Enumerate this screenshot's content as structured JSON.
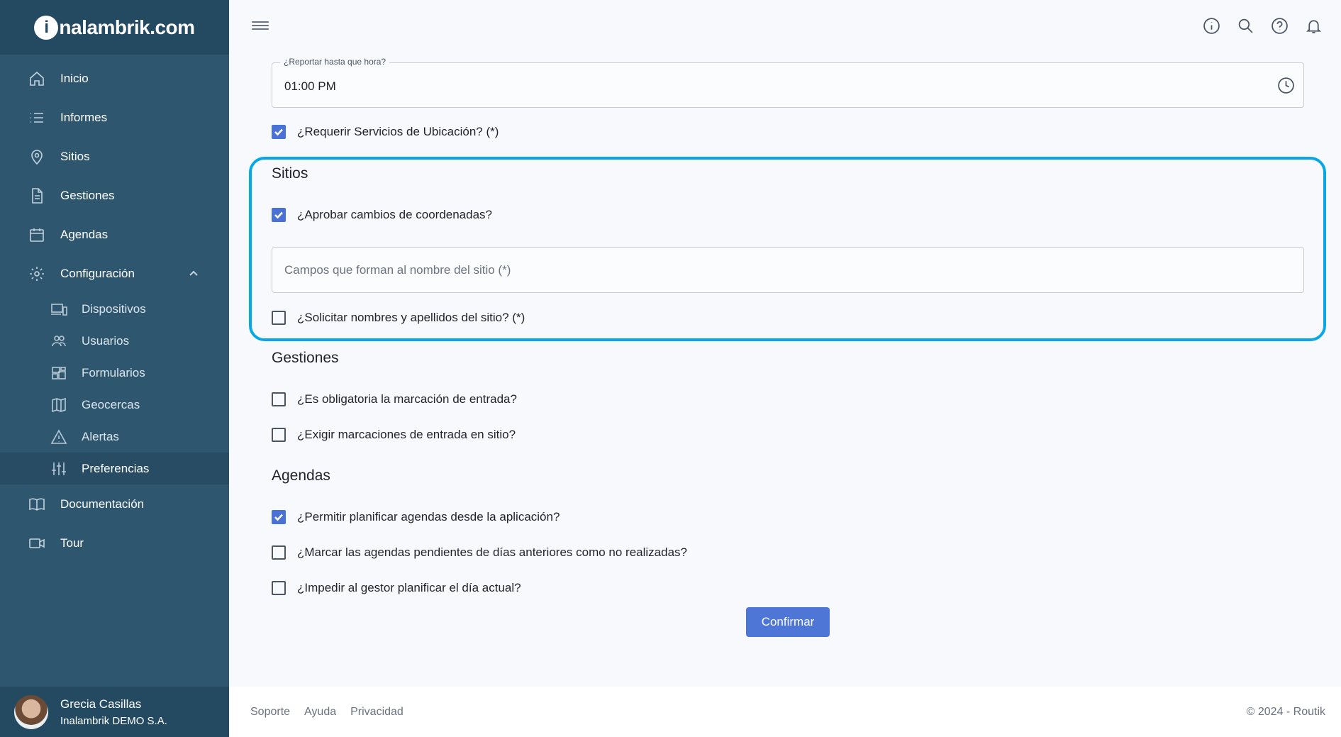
{
  "brand": {
    "logo_letter": "i",
    "logo_text": "nalambrik.com"
  },
  "sidebar": {
    "items": [
      {
        "label": "Inicio",
        "icon": "home-icon"
      },
      {
        "label": "Informes",
        "icon": "list-icon"
      },
      {
        "label": "Sitios",
        "icon": "map-pin-icon"
      },
      {
        "label": "Gestiones",
        "icon": "document-icon"
      },
      {
        "label": "Agendas",
        "icon": "calendar-icon"
      },
      {
        "label": "Configuración",
        "icon": "gear-icon",
        "expanded": true
      }
    ],
    "subitems": [
      {
        "label": "Dispositivos",
        "icon": "devices-icon"
      },
      {
        "label": "Usuarios",
        "icon": "users-icon"
      },
      {
        "label": "Formularios",
        "icon": "forms-icon"
      },
      {
        "label": "Geocercas",
        "icon": "map-icon"
      },
      {
        "label": "Alertas",
        "icon": "warning-icon"
      },
      {
        "label": "Preferencias",
        "icon": "sliders-icon",
        "active": true
      }
    ],
    "bottom_items": [
      {
        "label": "Documentación",
        "icon": "book-icon"
      },
      {
        "label": "Tour",
        "icon": "video-icon"
      }
    ]
  },
  "user": {
    "name": "Grecia Casillas",
    "org": "Inalambrik DEMO S.A."
  },
  "header": {
    "icons": [
      "info-icon",
      "search-icon",
      "help-icon",
      "bell-icon"
    ]
  },
  "form": {
    "report_until": {
      "label": "¿Reportar hasta que hora?",
      "value": "01:00 PM"
    },
    "require_location": {
      "label": "¿Requerir Servicios de Ubicación? (*)",
      "checked": true
    },
    "sitios": {
      "title": "Sitios",
      "approve_coords": {
        "label": "¿Aprobar cambios de coordenadas?",
        "checked": true
      },
      "name_fields_placeholder": "Campos que forman al nombre del sitio (*)",
      "request_names": {
        "label": "¿Solicitar nombres y apellidos del sitio? (*)",
        "checked": false
      }
    },
    "gestiones": {
      "title": "Gestiones",
      "mandatory_checkin": {
        "label": "¿Es obligatoria la marcación de entrada?",
        "checked": false
      },
      "require_checkin_site": {
        "label": "¿Exigir marcaciones de entrada en sitio?",
        "checked": false
      }
    },
    "agendas": {
      "title": "Agendas",
      "allow_planning": {
        "label": "¿Permitir planificar agendas desde la aplicación?",
        "checked": true
      },
      "mark_pending": {
        "label": "¿Marcar las agendas pendientes de días anteriores como no realizadas?",
        "checked": false
      },
      "prevent_today": {
        "label": "¿Impedir al gestor planificar el día actual?",
        "checked": false
      }
    },
    "confirm_label": "Confirmar"
  },
  "footer": {
    "links": [
      "Soporte",
      "Ayuda",
      "Privacidad"
    ],
    "copyright": "© 2024 - Routik"
  },
  "colors": {
    "sidebar": "#2f566f",
    "accent": "#4e76d7",
    "highlight": "#08a8e6"
  }
}
